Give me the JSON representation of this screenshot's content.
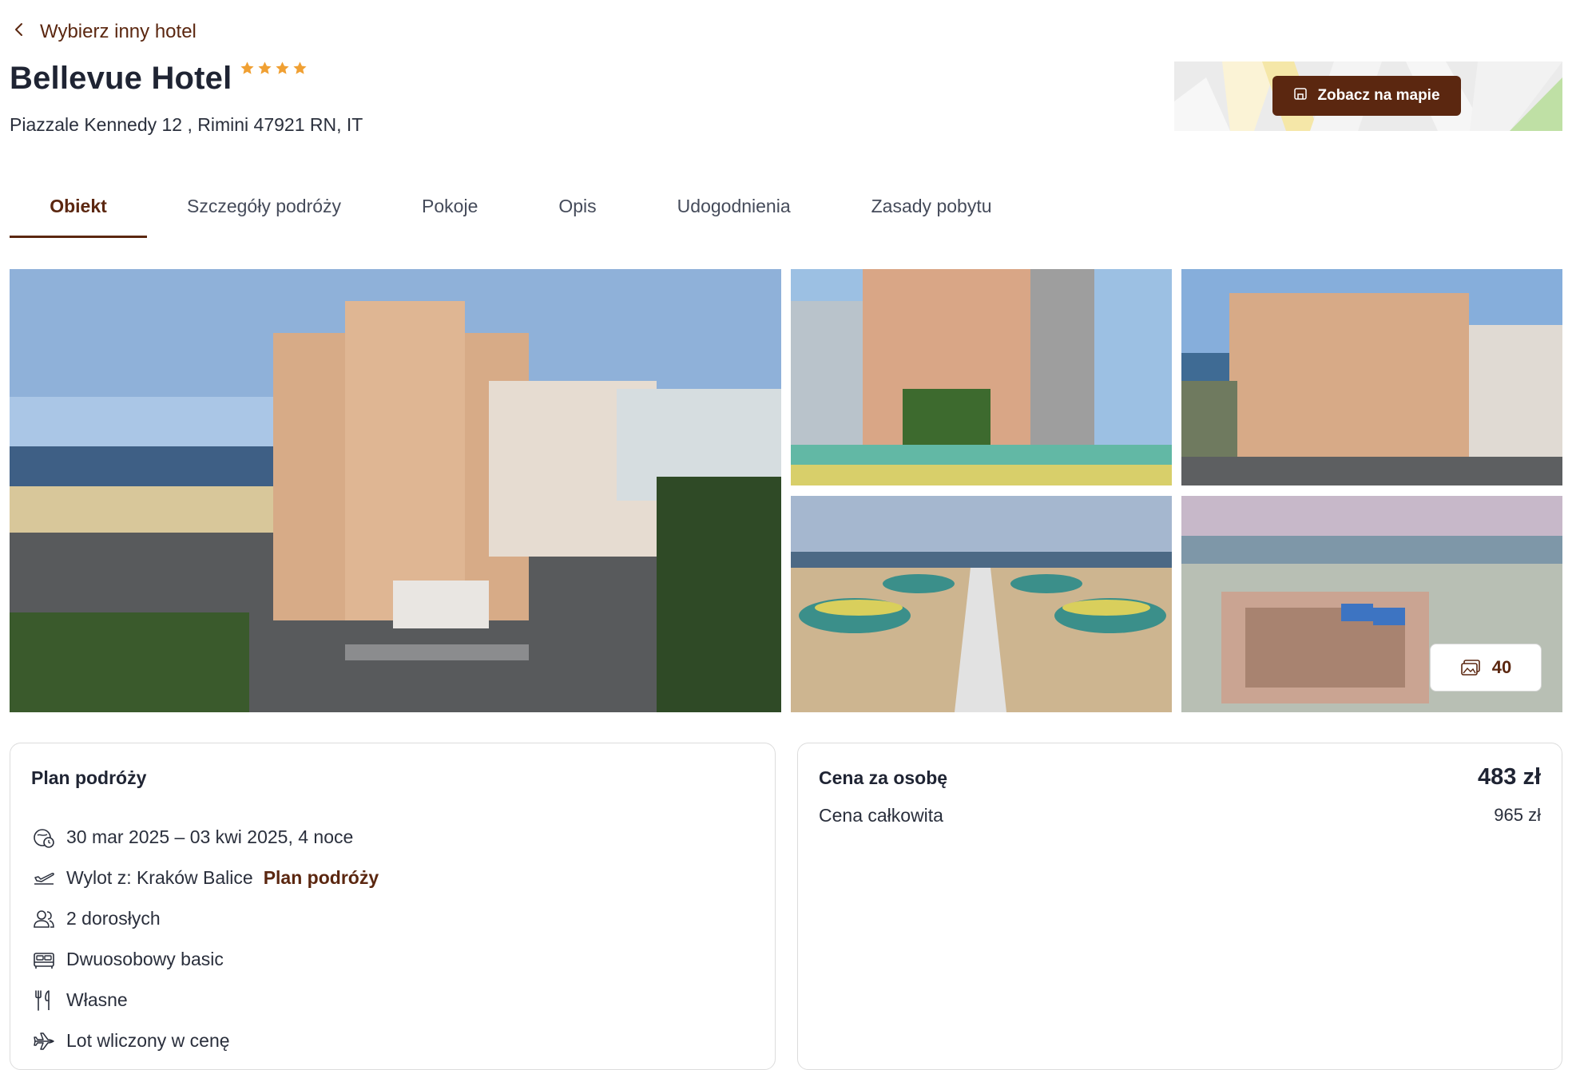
{
  "nav": {
    "back_label": "Wybierz inny hotel"
  },
  "hotel": {
    "name": "Bellevue Hotel",
    "stars": 4,
    "address": "Piazzale Kennedy 12 , Rimini 47921 RN, IT"
  },
  "map": {
    "button_label": "Zobacz na mapie"
  },
  "tabs": [
    {
      "label": "Obiekt",
      "active": true
    },
    {
      "label": "Szczegóły podróży",
      "active": false
    },
    {
      "label": "Pokoje",
      "active": false
    },
    {
      "label": "Opis",
      "active": false
    },
    {
      "label": "Udogodnienia",
      "active": false
    },
    {
      "label": "Zasady pobytu",
      "active": false
    }
  ],
  "gallery": {
    "photo_count": "40"
  },
  "plan": {
    "title": "Plan podróży",
    "dates": "30 mar 2025 – 03 kwi 2025, 4 noce",
    "departure": "Wylot z: Kraków Balice",
    "departure_link": "Plan podróży",
    "guests": "2 dorosłych",
    "room": "Dwuosobowy basic",
    "board": "Własne",
    "flight": "Lot wliczony w cenę"
  },
  "price": {
    "per_person_label": "Cena za osobę",
    "per_person_value": "483 zł",
    "total_label": "Cena całkowita",
    "total_value": "965 zł"
  },
  "colors": {
    "brand": "#5b2710",
    "star": "#f0a033",
    "text": "#1f2433"
  }
}
